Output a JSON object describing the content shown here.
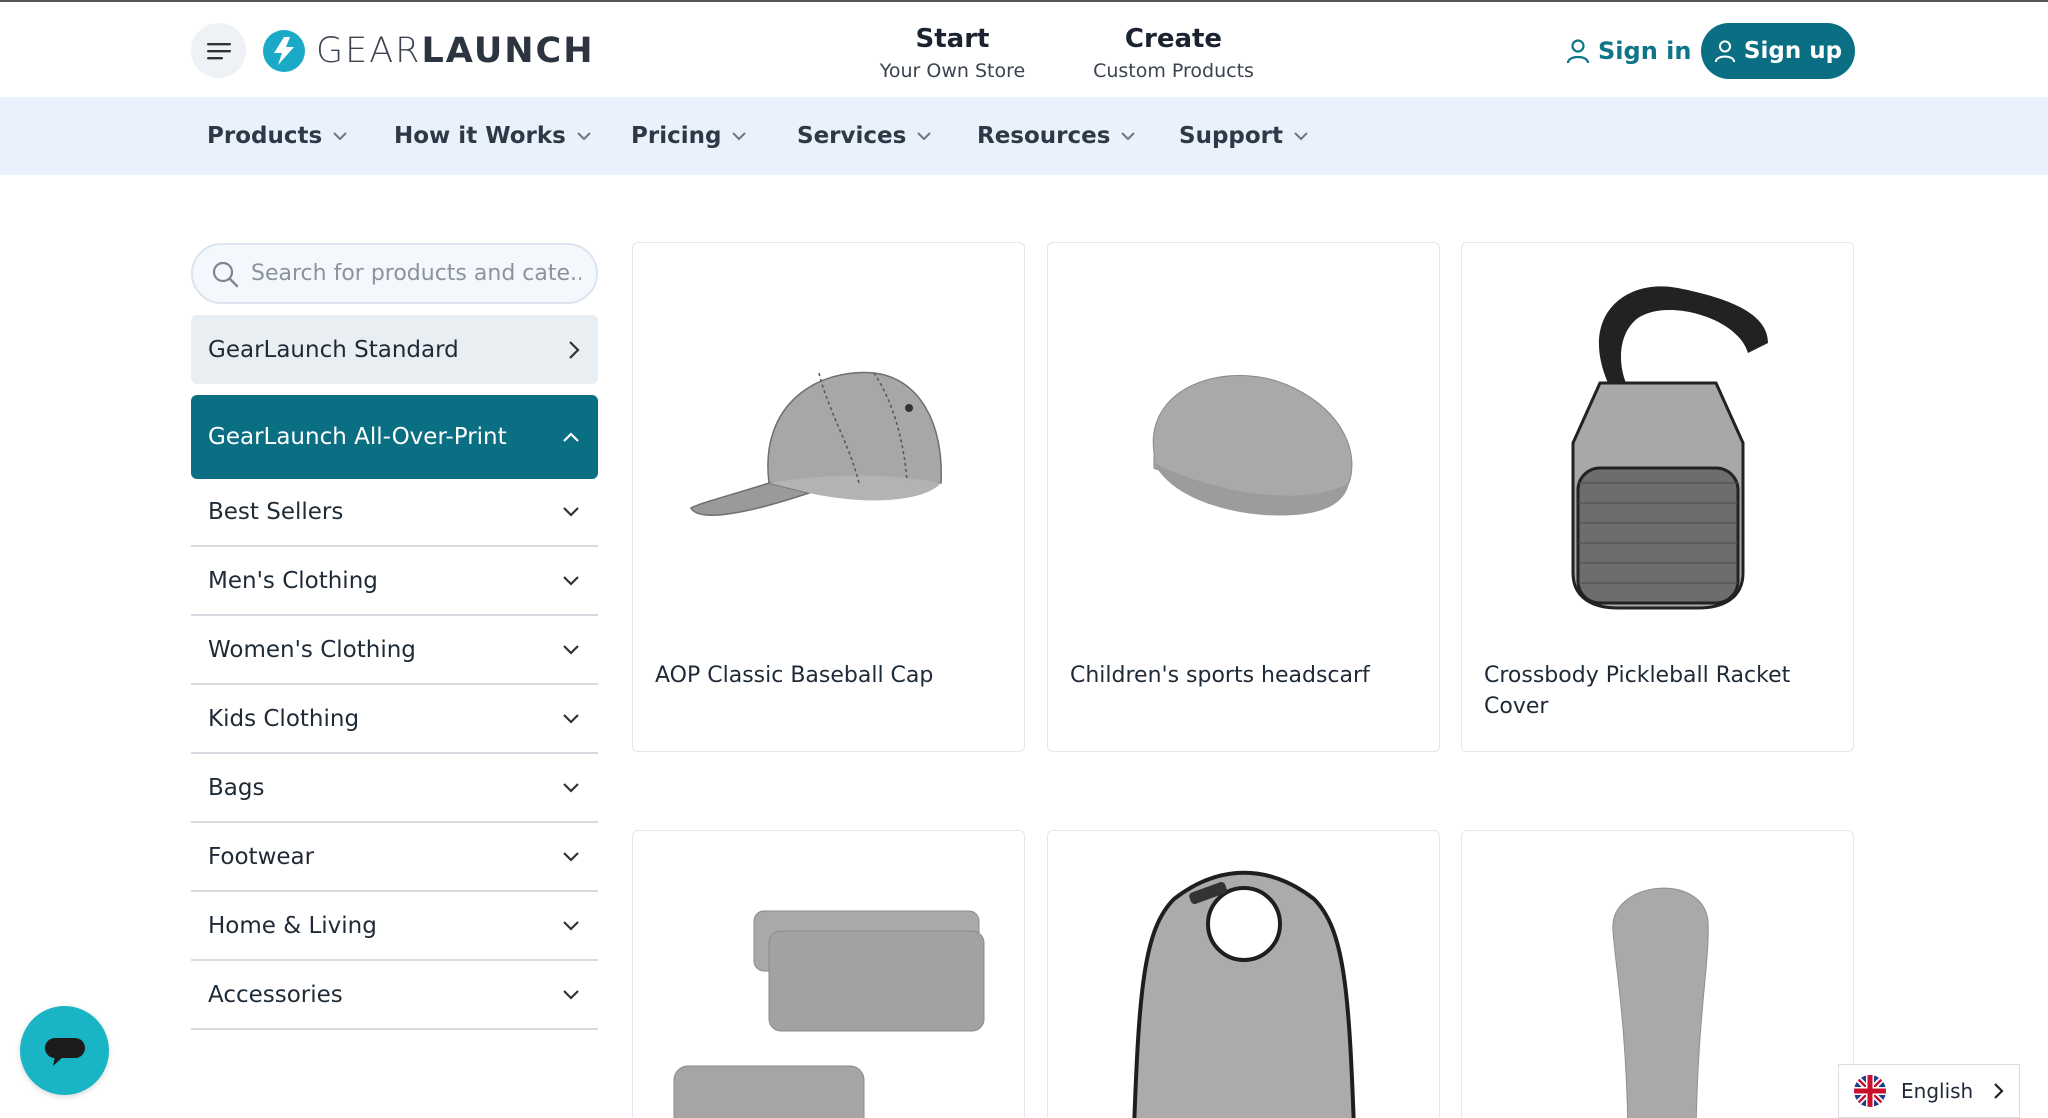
{
  "brand": {
    "name_light": "GEAR",
    "name_bold": "LAUNCH",
    "accent": "#0b6f84",
    "nav_bg": "#e9f2fc"
  },
  "header": {
    "links": [
      {
        "title": "Start",
        "subtitle": "Your Own Store"
      },
      {
        "title": "Create",
        "subtitle": "Custom Products"
      }
    ],
    "signin_label": "Sign in",
    "signup_label": "Sign up"
  },
  "nav": {
    "items": [
      {
        "label": "Products"
      },
      {
        "label": "How it Works"
      },
      {
        "label": "Pricing"
      },
      {
        "label": "Services"
      },
      {
        "label": "Resources"
      },
      {
        "label": "Support"
      }
    ]
  },
  "sidebar": {
    "search_placeholder": "Search for products and cate..",
    "standard_label": "GearLaunch Standard",
    "aop_label": "GearLaunch All-Over-Print",
    "categories": [
      {
        "label": "Best Sellers"
      },
      {
        "label": "Men's Clothing"
      },
      {
        "label": "Women's Clothing"
      },
      {
        "label": "Kids Clothing"
      },
      {
        "label": "Bags"
      },
      {
        "label": "Footwear"
      },
      {
        "label": "Home & Living"
      },
      {
        "label": "Accessories"
      }
    ]
  },
  "products": [
    {
      "name": "AOP Classic Baseball Cap",
      "icon": "baseball-cap-image"
    },
    {
      "name": "Children's sports headscarf",
      "icon": "headscarf-image"
    },
    {
      "name": "Crossbody Pickleball Racket Cover",
      "icon": "racket-cover-image"
    },
    {
      "name": "",
      "icon": "pillows-image"
    },
    {
      "name": "",
      "icon": "bib-image"
    },
    {
      "name": "",
      "icon": "golf-headcover-image"
    }
  ],
  "language": {
    "label": "English"
  }
}
